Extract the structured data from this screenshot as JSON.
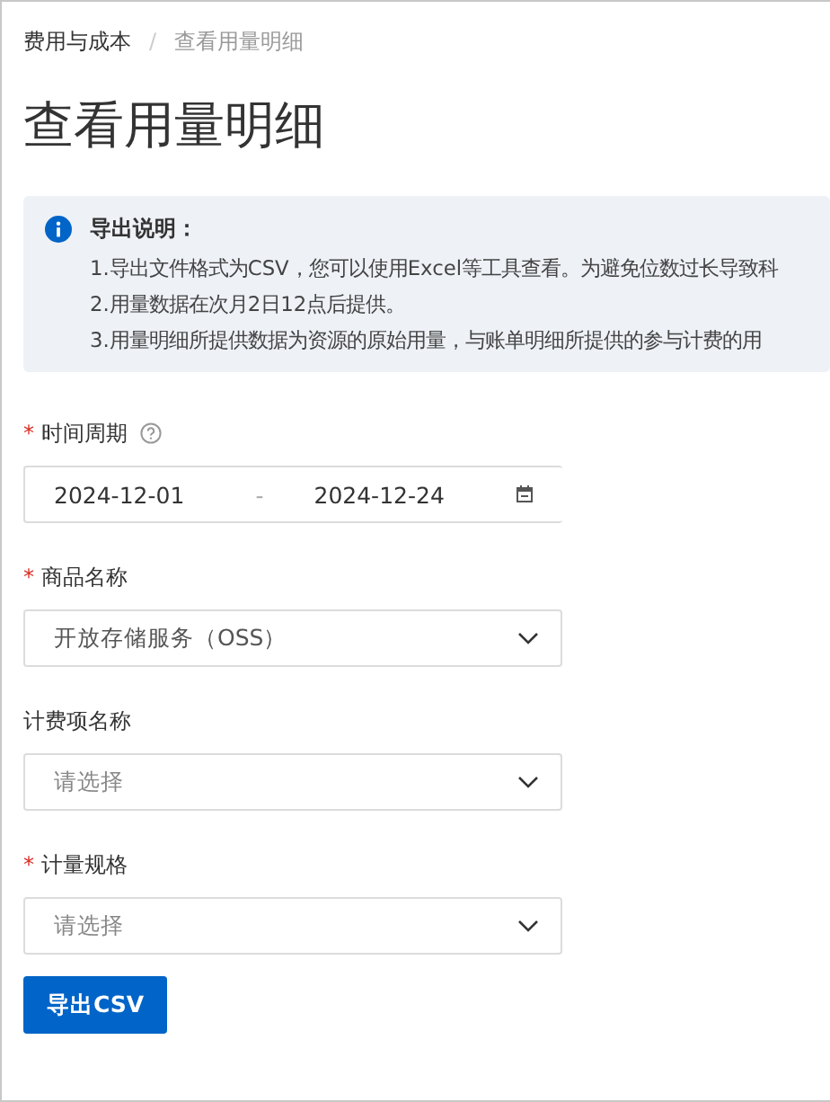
{
  "breadcrumb": [
    {
      "label": "费用与成本",
      "current": false
    },
    {
      "label": "查看用量明细",
      "current": true
    }
  ],
  "breadcrumb_separator": "/",
  "title": "查看用量明细",
  "notice": {
    "title": "导出说明：",
    "lines": [
      "1.导出文件格式为CSV，您可以使用Excel等工具查看。为避免位数过长导致科",
      "2.用量数据在次月2日12点后提供。",
      "3.用量明细所提供数据为资源的原始用量，与账单明细所提供的参与计费的用"
    ]
  },
  "fields": [
    {
      "kind": "date-range",
      "label": "时间周期",
      "required_mark": "*",
      "help": true,
      "start": "2024-12-01",
      "separator": "-",
      "end": "2024-12-24"
    },
    {
      "kind": "select",
      "label": "商品名称",
      "required_mark": "*",
      "help": false,
      "value": "开放存储服务（OSS）"
    },
    {
      "kind": "select",
      "label": "计费项名称",
      "help": false,
      "placeholder": "请选择"
    },
    {
      "kind": "select",
      "label": "计量规格",
      "required_mark": "*",
      "help": false,
      "placeholder": "请选择"
    }
  ],
  "button": "导出CSV"
}
